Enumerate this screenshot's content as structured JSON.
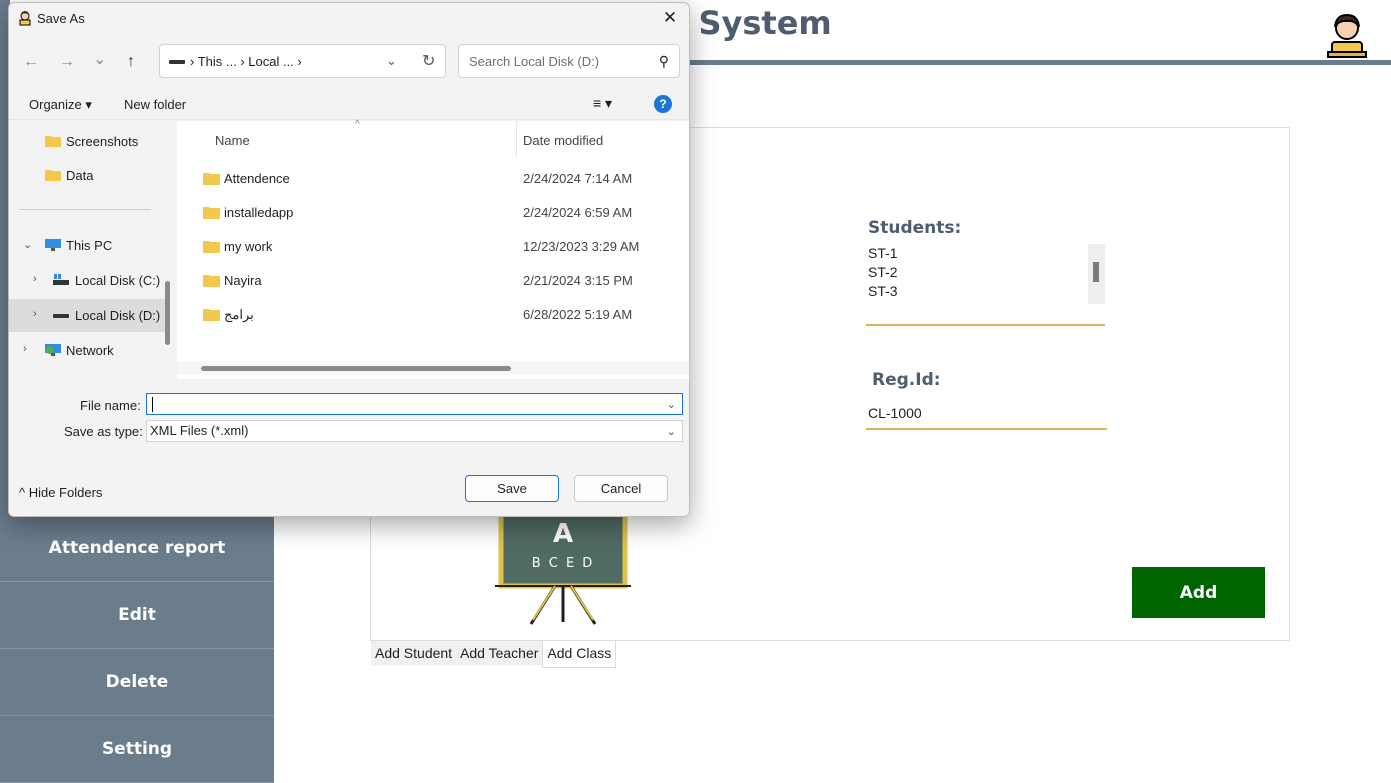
{
  "app": {
    "title": "t System",
    "sidebar": [
      {
        "label": "Attendence report"
      },
      {
        "label": "Edit"
      },
      {
        "label": "Delete"
      },
      {
        "label": "Setting"
      }
    ],
    "students_label": "Students:",
    "students": [
      "ST-1",
      "ST-2",
      "ST-3"
    ],
    "reg_label": "Reg.Id:",
    "reg_value": "CL-1000",
    "add_button": "Add",
    "board_letter": "A",
    "board_letters": "B C E D",
    "tabs": [
      {
        "label": "Add Student",
        "active": false
      },
      {
        "label": "Add Teacher",
        "active": false
      },
      {
        "label": "Add Class",
        "active": true
      }
    ],
    "accent_color": "#006400",
    "underline_color": "#e0b25a",
    "sidebar_color": "#6b7c8d"
  },
  "dialog": {
    "title": "Save As",
    "close_glyph": "✕",
    "nav": {
      "back": "←",
      "forward": "→",
      "recent": "⌄",
      "up": "↑"
    },
    "address": "› This ...  › Local ...  ›",
    "address_chevron": "⌄",
    "refresh_glyph": "↻",
    "search_placeholder": "Search Local Disk (D:)",
    "search_glyph": "⚲",
    "organize": "Organize ▾",
    "new_folder": "New folder",
    "view_glyph": "≡ ▾",
    "help_glyph": "?",
    "tree": [
      {
        "label": "Screenshots",
        "icon": "folder-icon",
        "chevron": "",
        "selected": false
      },
      {
        "label": "Data",
        "icon": "folder-icon",
        "chevron": "",
        "selected": false
      },
      {
        "label": "This PC",
        "icon": "monitor-icon",
        "chevron": "⌄",
        "selected": false
      },
      {
        "label": "Local Disk (C:)",
        "icon": "windows-drive-icon",
        "chevron": "›",
        "selected": false
      },
      {
        "label": "Local Disk (D:)",
        "icon": "drive-icon",
        "chevron": "›",
        "selected": true
      },
      {
        "label": "Network",
        "icon": "network-icon",
        "chevron": "›",
        "selected": false
      }
    ],
    "columns": {
      "name": "Name",
      "date": "Date modified",
      "sort_glyph": "^"
    },
    "files": [
      {
        "name": "Attendence",
        "date": "2/24/2024 7:14 AM"
      },
      {
        "name": "installedapp",
        "date": "2/24/2024 6:59 AM"
      },
      {
        "name": "my work",
        "date": "12/23/2023 3:29 AM"
      },
      {
        "name": "Nayira",
        "date": "2/21/2024 3:15 PM"
      },
      {
        "name": "برامج",
        "date": "6/28/2022 5:19 AM"
      }
    ],
    "file_name_label": "File name:",
    "file_name_value": "",
    "save_type_label": "Save as type:",
    "save_type_value": "XML Files (*.xml)",
    "hide_folders": "^ Hide Folders",
    "save_button": "Save",
    "cancel_button": "Cancel",
    "folder_color": "#f2c94c",
    "focus_color": "#1976d2"
  }
}
